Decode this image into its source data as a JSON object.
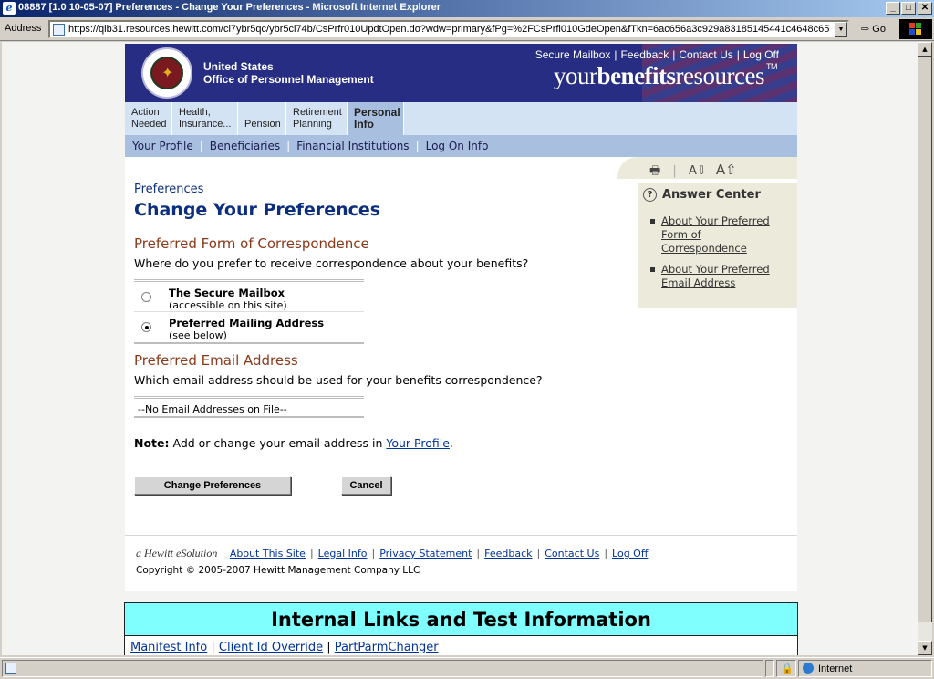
{
  "window": {
    "title": "08887 [1.0 10-05-07] Preferences - Change Your Preferences - Microsoft Internet Explorer",
    "min": "_",
    "max": "□",
    "close": "✕"
  },
  "addressbar": {
    "label": "Address",
    "url": "https://qlb31.resources.hewitt.com/cl7ybr5qc/ybr5cl74b/CsPrfr010UpdtOpen.do?wdw=primary&fPg=%2FCsPrfl010GdeOpen&fTkn=6ac656a3c929a83185145441c4648c65",
    "go": "Go"
  },
  "header": {
    "org_line1": "United States",
    "org_line2": "Office of Personnel Management",
    "links": [
      "Secure Mailbox",
      "Feedback",
      "Contact Us",
      "Log Off"
    ],
    "brand_light1": "your",
    "brand_bold": "benefits",
    "brand_light2": "resources",
    "brand_tm": "TM"
  },
  "tabs": [
    {
      "line1": "Action",
      "line2": "Needed"
    },
    {
      "line1": "Health,",
      "line2": "Insurance..."
    },
    {
      "line1": "",
      "line2": "Pension"
    },
    {
      "line1": "Retirement",
      "line2": "Planning"
    },
    {
      "line1": "Personal",
      "line2": "Info"
    }
  ],
  "subnav": [
    "Your Profile",
    "Beneficiaries",
    "Financial Institutions",
    "Log On Info"
  ],
  "main": {
    "eyebrow": "Preferences",
    "title": "Change Your Preferences",
    "section1": "Preferred Form of Correspondence",
    "question1": "Where do you prefer to receive correspondence about your benefits?",
    "options": [
      {
        "title": "The Secure Mailbox",
        "sub": "(accessible on this site)",
        "selected": false
      },
      {
        "title": "Preferred Mailing Address",
        "sub": "(see below)",
        "selected": true
      }
    ],
    "section2": "Preferred Email Address",
    "question2": "Which email address should be used for your benefits correspondence?",
    "no_email": "--No Email Addresses on File--",
    "note_label": "Note:",
    "note_text": " Add or change your email address in ",
    "note_link": "Your Profile",
    "note_end": ".",
    "change_button": "Change Preferences",
    "cancel_button": "Cancel"
  },
  "sidebar": {
    "font_smaller": "A⇩",
    "font_larger": "A⇧",
    "answer_center_title": "Answer Center",
    "links": [
      "About Your Preferred Form of Correspondence",
      "About Your Preferred Email Address"
    ]
  },
  "footer": {
    "hewitt": "a Hewitt eSolution",
    "links": [
      "About This Site",
      "Legal Info",
      "Privacy Statement",
      "Feedback",
      "Contact Us",
      "Log Off"
    ],
    "copyright": "Copyright © 2005-2007 Hewitt Management Company LLC"
  },
  "internal": {
    "heading": "Internal Links and Test Information",
    "links": [
      "Manifest Info",
      "Client Id Override",
      "PartParmChanger"
    ]
  },
  "status": {
    "zone": "Internet"
  },
  "colors": {
    "header_bg": "#262d83",
    "title_blue": "#0b2f7e",
    "section_brown": "#8a3a1a",
    "link_blue": "#00339b",
    "internal_bg": "#80ffff"
  }
}
